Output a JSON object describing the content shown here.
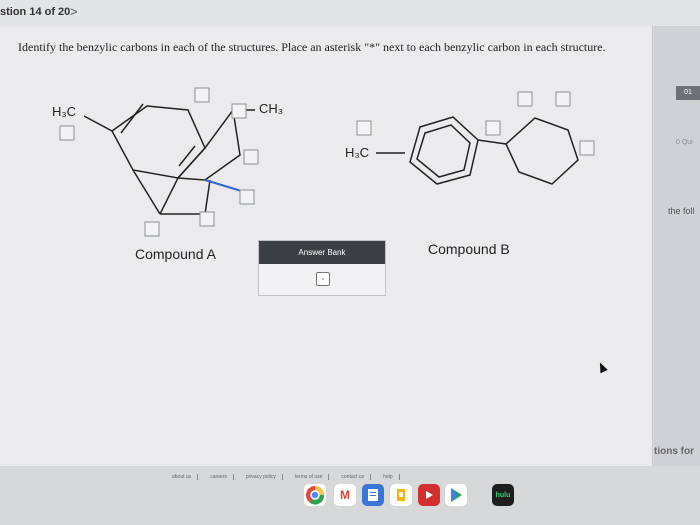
{
  "header": {
    "question_counter": "stion 14 of 20",
    "next_label": ">"
  },
  "prompt": "Identify the benzylic carbons in each of the structures. Place an asterisk \"*\" next to each benzylic carbon in each structure.",
  "compound_a": {
    "label": "Compound A",
    "h3c": "H₃C",
    "ch3": "CH₃"
  },
  "compound_b": {
    "label": "Compound B",
    "h3c": "H₃C"
  },
  "answer_bank": {
    "header": "Answer Bank",
    "token": "·"
  },
  "right_panel": {
    "badge": "01",
    "small": "0 Qui",
    "follow": "the foll",
    "bottom": "tions for"
  },
  "footer": {
    "links": [
      "about us",
      "careers",
      "privacy policy",
      "terms of use",
      "contact us",
      "help"
    ]
  },
  "dock": {
    "hulu_label": "hulu"
  },
  "colors": {
    "selected_bond": "#3366cc",
    "answer_header": "#3b4044"
  }
}
